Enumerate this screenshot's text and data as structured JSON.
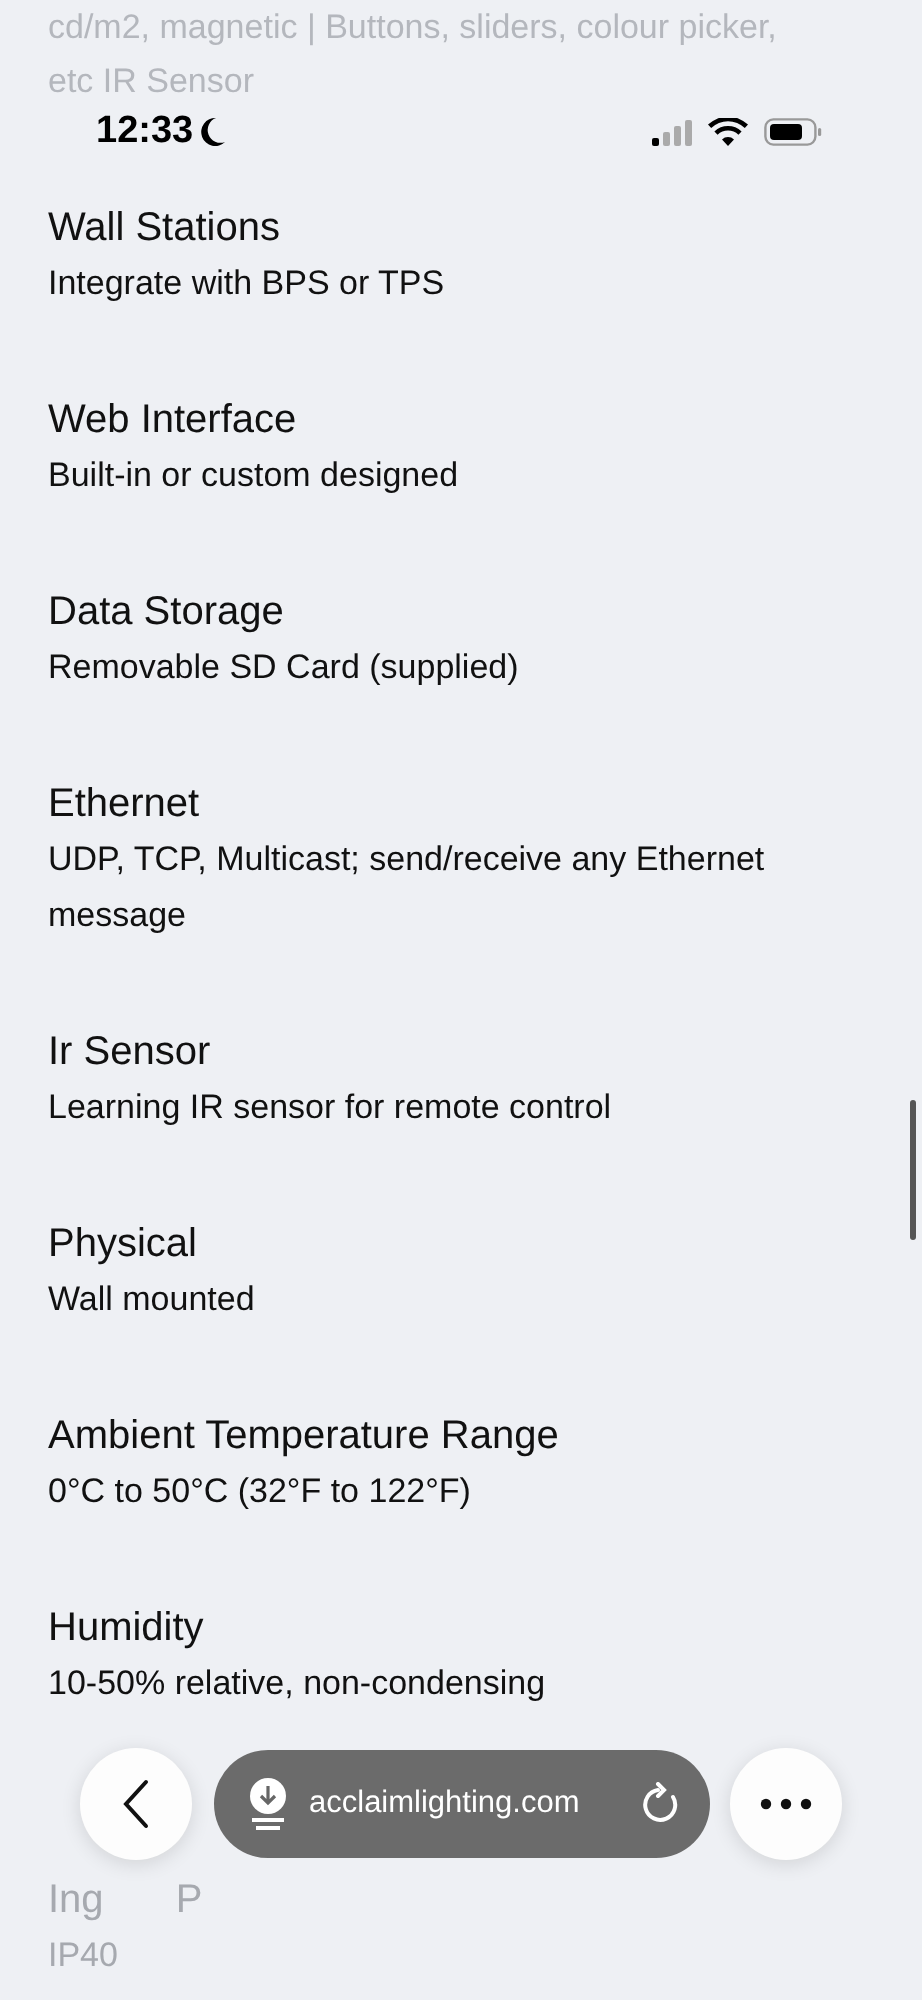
{
  "status_bar": {
    "time": "12:33"
  },
  "top_text": [
    "cd/m2, magnetic | Buttons, sliders, colour picker,",
    "etc IR Sensor"
  ],
  "specs": [
    {
      "title": "Wall Stations",
      "value": "Integrate with BPS or TPS"
    },
    {
      "title": "Web Interface",
      "value": "Built-in or custom designed"
    },
    {
      "title": "Data Storage",
      "value": "Removable SD Card (supplied)"
    },
    {
      "title": "Ethernet",
      "value": "UDP, TCP, Multicast; send/receive any Ethernet message"
    },
    {
      "title": "Ir Sensor",
      "value": "Learning IR sensor for remote control"
    },
    {
      "title": "Physical",
      "value": "Wall mounted"
    },
    {
      "title": "Ambient Temperature Range",
      "value": "0°C to 50°C (32°F to 122°F)"
    },
    {
      "title": "Humidity",
      "value": "10-50% relative, non-condensing"
    }
  ],
  "last_spec": {
    "title_parts": [
      "Ing",
      "P"
    ],
    "value": "IP40"
  },
  "toolbar": {
    "url": "acclaimlighting.com"
  }
}
